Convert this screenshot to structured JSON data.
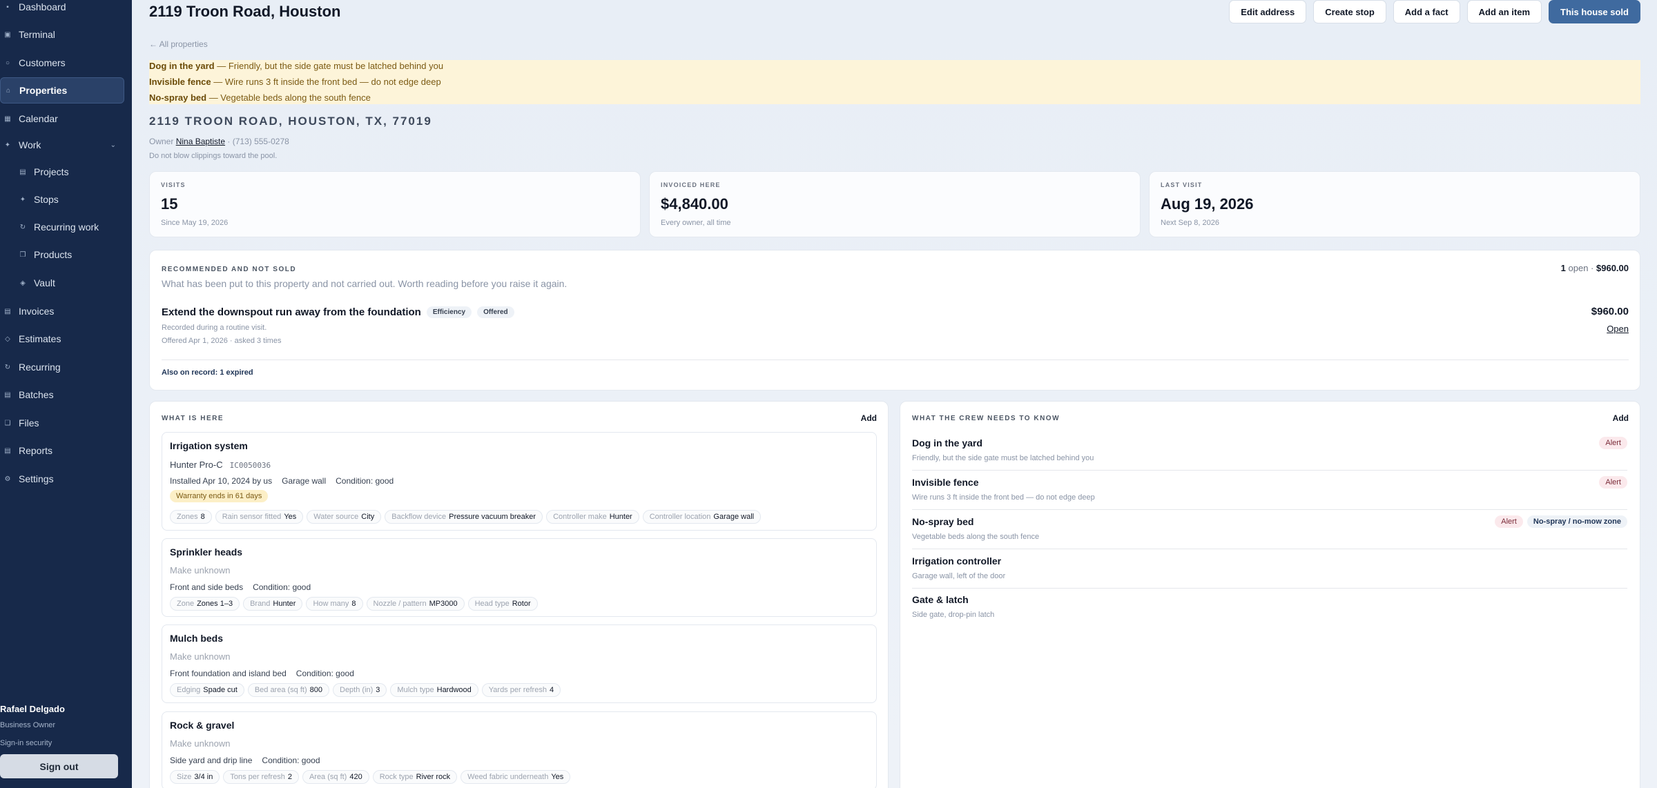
{
  "sidebar": {
    "items": [
      {
        "label": "Dashboard",
        "icon": "dashboard-icon",
        "glyph": "▪"
      },
      {
        "label": "Terminal",
        "icon": "terminal-icon",
        "glyph": "▣"
      },
      {
        "label": "Customers",
        "icon": "customers-icon",
        "glyph": "○"
      },
      {
        "label": "Properties",
        "icon": "home-icon",
        "glyph": "⌂"
      },
      {
        "label": "Calendar",
        "icon": "calendar-icon",
        "glyph": "▦"
      },
      {
        "label": "Work",
        "icon": "work-icon",
        "glyph": "✦"
      },
      {
        "label": "Projects",
        "icon": "projects-icon",
        "glyph": "▤"
      },
      {
        "label": "Stops",
        "icon": "stops-icon",
        "glyph": "✦"
      },
      {
        "label": "Recurring work",
        "icon": "recurring-work-icon",
        "glyph": "↻"
      },
      {
        "label": "Products",
        "icon": "products-icon",
        "glyph": "❒"
      },
      {
        "label": "Vault",
        "icon": "vault-icon",
        "glyph": "◈"
      },
      {
        "label": "Invoices",
        "icon": "invoices-icon",
        "glyph": "▤"
      },
      {
        "label": "Estimates",
        "icon": "estimates-icon",
        "glyph": "◇"
      },
      {
        "label": "Recurring",
        "icon": "recurring-icon",
        "glyph": "↻"
      },
      {
        "label": "Batches",
        "icon": "batches-icon",
        "glyph": "▤"
      },
      {
        "label": "Files",
        "icon": "files-icon",
        "glyph": "❑"
      },
      {
        "label": "Reports",
        "icon": "reports-icon",
        "glyph": "▤"
      },
      {
        "label": "Settings",
        "icon": "settings-icon",
        "glyph": "⚙"
      }
    ],
    "work_chevron": "⌄",
    "user": {
      "name": "Rafael Delgado",
      "role": "Business Owner",
      "security": "Sign-in security",
      "signout": "Sign out"
    }
  },
  "header": {
    "title": "2119 Troon Road, Houston",
    "actions": [
      "Edit address",
      "Create stop",
      "Add a fact",
      "Add an item",
      "This house sold"
    ],
    "back": "← All properties"
  },
  "alerts": [
    {
      "name": "Dog in the yard",
      "text": " — Friendly, but the side gate must be latched behind you"
    },
    {
      "name": "Invisible fence",
      "text": " — Wire runs 3 ft inside the front bed — do not edge deep"
    },
    {
      "name": "No-spray bed",
      "text": " — Vegetable beds along the south fence"
    }
  ],
  "property": {
    "address": "2119 TROON ROAD, HOUSTON, TX, 77019",
    "owner_label": "Owner",
    "owner_name": "Nina Baptiste",
    "owner_phone": "· (713) 555-0278",
    "note": "Do not blow clippings toward the pool."
  },
  "stats": [
    {
      "label": "VISITS",
      "value": "15",
      "sub": "Since May 19, 2026"
    },
    {
      "label": "INVOICED HERE",
      "value": "$4,840.00",
      "sub": "Every owner, all time"
    },
    {
      "label": "LAST VISIT",
      "value": "Aug 19, 2026",
      "sub": "Next Sep 8, 2026"
    }
  ],
  "recommended": {
    "heading": "RECOMMENDED AND NOT SOLD",
    "desc": "What has been put to this property and not carried out. Worth reading before you raise it again.",
    "open_count": "1",
    "open_label": " open · ",
    "open_total": "$960.00",
    "item": {
      "title": "Extend the downspout run away from the foundation",
      "tags": [
        "Efficiency",
        "Offered"
      ],
      "note": "Recorded during a routine visit.",
      "offered": "Offered Apr 1, 2026 · asked 3 times",
      "price": "$960.00",
      "action": "Open"
    },
    "also": "Also on record: 1 expired"
  },
  "what_is_here": {
    "heading": "WHAT IS HERE",
    "add": "Add",
    "assets": [
      {
        "name": "Irrigation system",
        "make": "Hunter Pro-C",
        "serial": "IC0050036",
        "installed": "Installed Apr 10, 2024 by us",
        "location": "Garage wall",
        "condition": "Condition: good",
        "warranty": "Warranty ends in 61 days",
        "chips": [
          [
            "Zones",
            "8"
          ],
          [
            "Rain sensor fitted",
            "Yes"
          ],
          [
            "Water source",
            "City"
          ],
          [
            "Backflow device",
            "Pressure vacuum breaker"
          ],
          [
            "Controller make",
            "Hunter"
          ],
          [
            "Controller location",
            "Garage wall"
          ]
        ]
      },
      {
        "name": "Sprinkler heads",
        "make": "Make unknown",
        "location": "Front and side beds",
        "condition": "Condition: good",
        "chips": [
          [
            "Zone",
            "Zones 1–3"
          ],
          [
            "Brand",
            "Hunter"
          ],
          [
            "How many",
            "8"
          ],
          [
            "Nozzle / pattern",
            "MP3000"
          ],
          [
            "Head type",
            "Rotor"
          ]
        ]
      },
      {
        "name": "Mulch beds",
        "make": "Make unknown",
        "location": "Front foundation and island bed",
        "condition": "Condition: good",
        "chips": [
          [
            "Edging",
            "Spade cut"
          ],
          [
            "Bed area (sq ft)",
            "800"
          ],
          [
            "Depth (in)",
            "3"
          ],
          [
            "Mulch type",
            "Hardwood"
          ],
          [
            "Yards per refresh",
            "4"
          ]
        ]
      },
      {
        "name": "Rock & gravel",
        "make": "Make unknown",
        "location": "Side yard and drip line",
        "condition": "Condition: good",
        "chips": [
          [
            "Size",
            "3/4 in"
          ],
          [
            "Tons per refresh",
            "2"
          ],
          [
            "Area (sq ft)",
            "420"
          ],
          [
            "Rock type",
            "River rock"
          ],
          [
            "Weed fabric underneath",
            "Yes"
          ]
        ]
      }
    ]
  },
  "crew": {
    "heading": "WHAT THE CREW NEEDS TO KNOW",
    "add": "Add",
    "items": [
      {
        "name": "Dog in the yard",
        "desc": "Friendly, but the side gate must be latched behind you",
        "tags": [
          "Alert"
        ]
      },
      {
        "name": "Invisible fence",
        "desc": "Wire runs 3 ft inside the front bed — do not edge deep",
        "tags": [
          "Alert"
        ]
      },
      {
        "name": "No-spray bed",
        "desc": "Vegetable beds along the south fence",
        "tags": [
          "Alert",
          "No-spray / no-mow zone"
        ]
      },
      {
        "name": "Irrigation controller",
        "desc": "Garage wall, left of the door",
        "tags": []
      },
      {
        "name": "Gate & latch",
        "desc": "Side gate, drop-pin latch",
        "tags": []
      }
    ]
  }
}
